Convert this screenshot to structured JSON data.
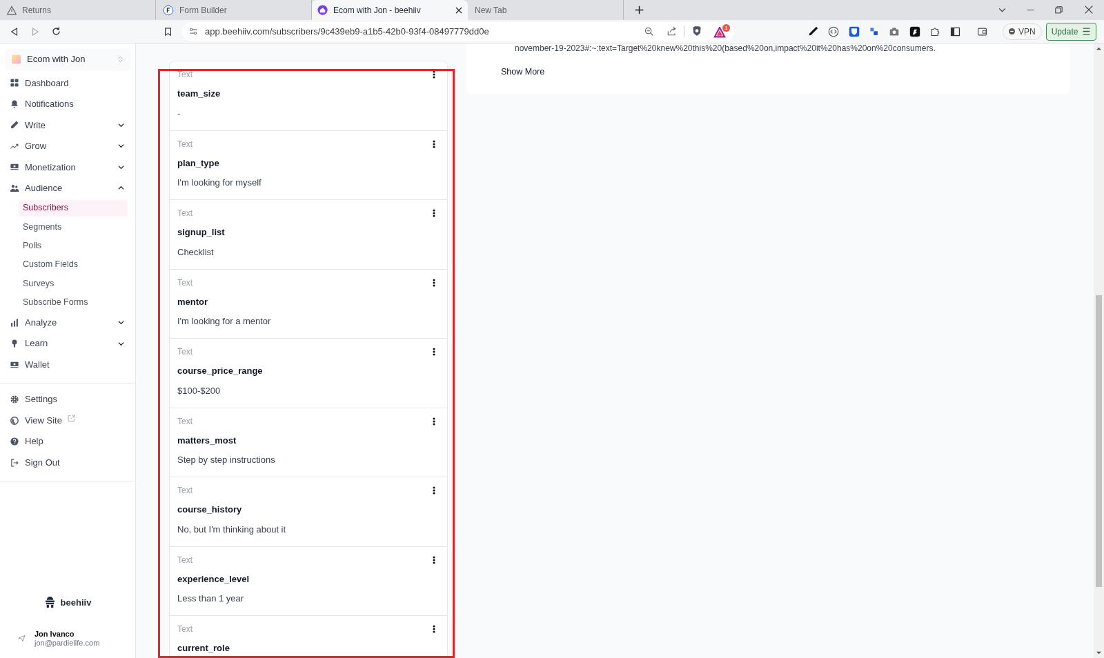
{
  "browser": {
    "tabs": [
      {
        "title": "Returns",
        "selected": false
      },
      {
        "title": "Form Builder",
        "selected": false
      },
      {
        "title": "Ecom with Jon - beehiiv",
        "selected": true
      },
      {
        "title": "New Tab",
        "selected": false
      }
    ],
    "url": "app.beehiiv.com/subscribers/9c439eb9-a1b5-42b0-93f4-08497779dd0e",
    "rewards_badge": "1",
    "vpn_label": "VPN",
    "update_label": "Update"
  },
  "sidebar": {
    "workspace": "Ecom with Jon",
    "nav": [
      {
        "label": "Dashboard"
      },
      {
        "label": "Notifications"
      },
      {
        "label": "Write",
        "expanded": false
      },
      {
        "label": "Grow",
        "expanded": false
      },
      {
        "label": "Monetization",
        "expanded": false
      },
      {
        "label": "Audience",
        "expanded": true,
        "children": [
          {
            "label": "Subscribers",
            "selected": true
          },
          {
            "label": "Segments",
            "selected": false
          },
          {
            "label": "Polls",
            "selected": false
          },
          {
            "label": "Custom Fields",
            "selected": false
          },
          {
            "label": "Surveys",
            "selected": false
          },
          {
            "label": "Subscribe Forms",
            "selected": false
          }
        ]
      },
      {
        "label": "Analyze",
        "expanded": false
      },
      {
        "label": "Learn",
        "expanded": false
      },
      {
        "label": "Wallet"
      }
    ],
    "footer": [
      {
        "label": "Settings",
        "external": false
      },
      {
        "label": "View Site",
        "external": true
      },
      {
        "label": "Help",
        "external": false
      },
      {
        "label": "Sign Out",
        "external": false
      }
    ],
    "brand": "beehiiv",
    "user": {
      "name": "Jon Ivanco",
      "email": "jon@pardielife.com"
    }
  },
  "fields": {
    "highlighted": true,
    "items": [
      {
        "type": "Text",
        "name": "team_size",
        "value": "-"
      },
      {
        "type": "Text",
        "name": "plan_type",
        "value": "I'm looking for myself"
      },
      {
        "type": "Text",
        "name": "signup_list",
        "value": "Checklist"
      },
      {
        "type": "Text",
        "name": "mentor",
        "value": "I'm looking for a mentor"
      },
      {
        "type": "Text",
        "name": "course_price_range",
        "value": "$100-$200"
      },
      {
        "type": "Text",
        "name": "matters_most",
        "value": "Step by step instructions"
      },
      {
        "type": "Text",
        "name": "course_history",
        "value": "No, but I'm thinking about it"
      },
      {
        "type": "Text",
        "name": "experience_level",
        "value": "Less than 1 year"
      },
      {
        "type": "Text",
        "name": "current_role"
      }
    ]
  },
  "details": {
    "link_text": "november-19-2023#:~:text=Target%20knew%20this%20(based%20on,impact%20it%20has%20on%20consumers.",
    "show_more": "Show More"
  }
}
